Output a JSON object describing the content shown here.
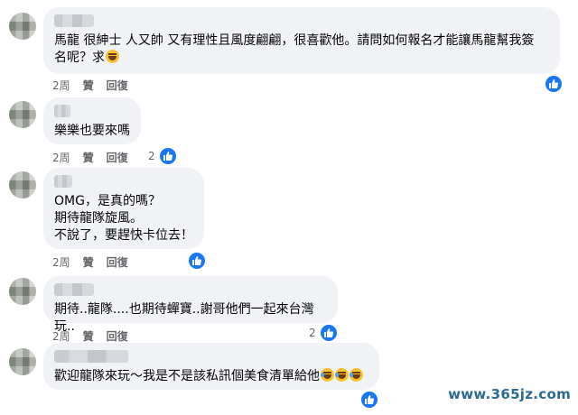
{
  "actions": {
    "like": "贊",
    "reply": "回復"
  },
  "comments": [
    {
      "time": "2周",
      "lines": [
        "馬龍 很紳士 人又帥 又有理性且風度翩翩，很喜歡他。請問如何報名才能讓馬龍幫我簽",
        "名呢？求"
      ],
      "like_count": ""
    },
    {
      "time": "2周",
      "lines": [
        "樂樂也要來嗎"
      ],
      "like_count": "2"
    },
    {
      "time": "2周",
      "lines": [
        "OMG，是真的嗎？",
        "期待龍隊旋風。",
        "不說了，要趕快卡位去！"
      ],
      "like_count": ""
    },
    {
      "time": "2周",
      "lines": [
        "期待..龍隊....也期待蟬寶..謝哥他們一起來台灣玩.."
      ],
      "like_count": "2"
    },
    {
      "time": "",
      "lines": [
        "歡迎龍隊來玩～我是不是該私訊個美食清單給他"
      ],
      "like_count": ""
    }
  ],
  "watermark": "www.365jz.com",
  "colors": {
    "bubble": "#f0f2f5",
    "like_blue": "#1877f2",
    "meta_text": "#65676b"
  }
}
